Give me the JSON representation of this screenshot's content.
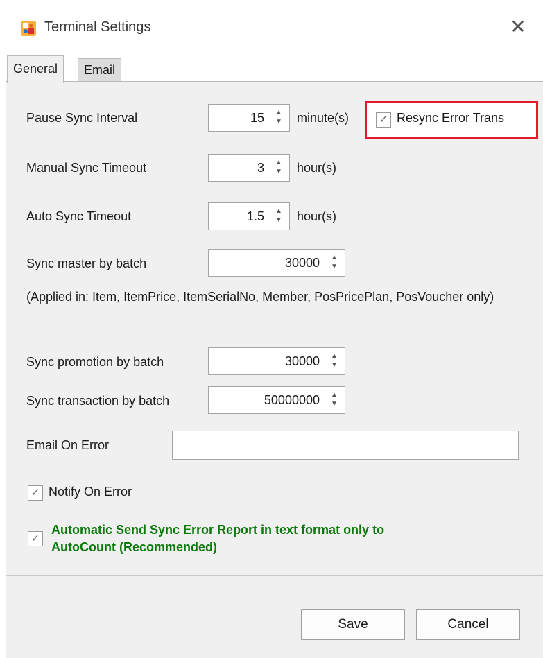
{
  "window": {
    "title": "Terminal Settings",
    "close_glyph": "✕",
    "icon": "app-logo-icon"
  },
  "tabs": [
    {
      "label": "General",
      "selected": true
    },
    {
      "label": "Email",
      "selected": false
    }
  ],
  "general": {
    "pause_sync": {
      "label": "Pause Sync Interval",
      "value": "15",
      "unit": "minute(s)"
    },
    "resync": {
      "label": "Resync Error Trans",
      "checked": true
    },
    "manual_sync": {
      "label": "Manual Sync Timeout",
      "value": "3",
      "unit": "hour(s)"
    },
    "auto_sync": {
      "label": "Auto Sync Timeout",
      "value": "1.5",
      "unit": "hour(s)"
    },
    "sync_master": {
      "label": "Sync master by batch",
      "value": "30000"
    },
    "applied_note": "(Applied in: Item, ItemPrice, ItemSerialNo, Member, PosPricePlan, PosVoucher only)",
    "sync_promotion": {
      "label": "Sync promotion by batch",
      "value": "30000"
    },
    "sync_transaction": {
      "label": "Sync transaction by batch",
      "value": "50000000"
    },
    "email_on_error": {
      "label": "Email On Error",
      "value": ""
    },
    "notify_on_error": {
      "label": "Notify On Error",
      "checked": true
    },
    "auto_send": {
      "label": "Automatic Send Sync Error Report in text format only to AutoCount (Recommended)",
      "checked": true
    }
  },
  "buttons": {
    "save": "Save",
    "cancel": "Cancel"
  },
  "glyphs": {
    "check": "✓",
    "up": "▲",
    "down": "▼"
  },
  "colors": {
    "highlight": "#e21b2b",
    "recommend_text": "#0a7a0a"
  }
}
